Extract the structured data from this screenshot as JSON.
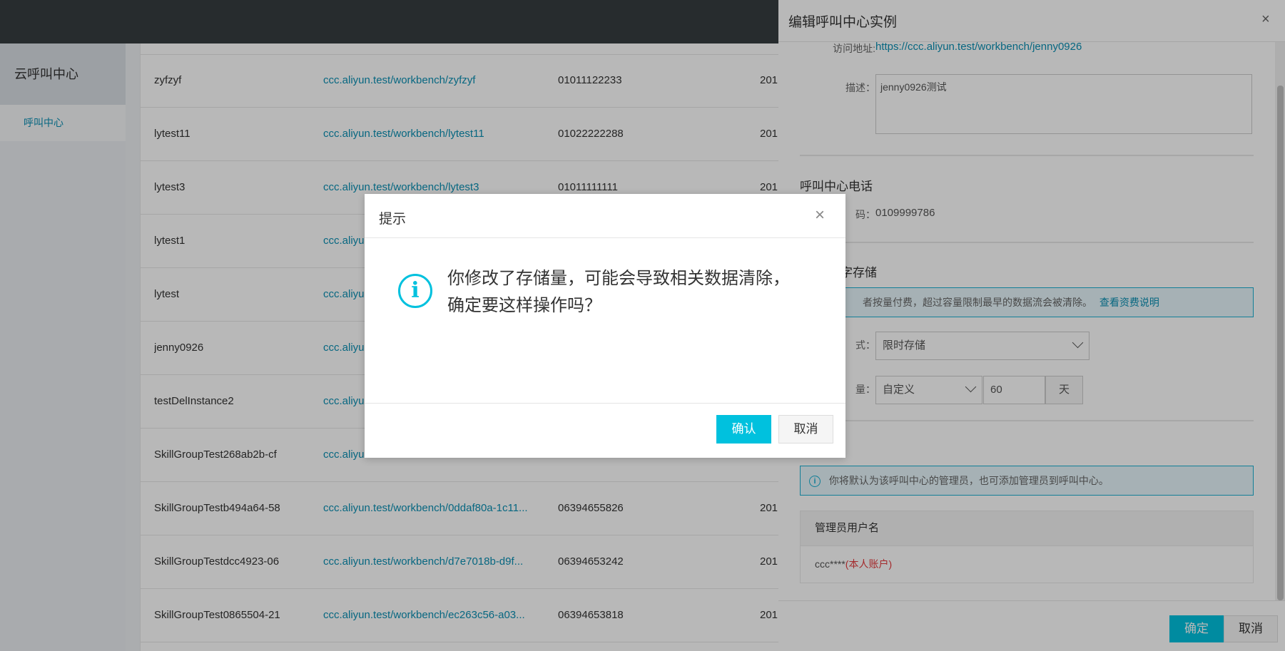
{
  "nav": {
    "title": "云呼叫中心",
    "active_item": "呼叫中心"
  },
  "table": {
    "rows": [
      {
        "name": "zyfzyf",
        "url": "ccc.aliyun.test/workbench/zyfzyf",
        "phone": "01011122233",
        "date": "201"
      },
      {
        "name": "lytest11",
        "url": "ccc.aliyun.test/workbench/lytest11",
        "phone": "01022222288",
        "date": "201"
      },
      {
        "name": "lytest3",
        "url": "ccc.aliyun.test/workbench/lytest3",
        "phone": "01011111111",
        "date": "201"
      },
      {
        "name": "lytest1",
        "url": "ccc.aliyu",
        "phone": "",
        "date": ""
      },
      {
        "name": "lytest",
        "url": "ccc.aliyu",
        "phone": "",
        "date": ""
      },
      {
        "name": "jenny0926",
        "url": "ccc.aliyu",
        "phone": "",
        "date": ""
      },
      {
        "name": "testDelInstance2",
        "url": "ccc.aliyu",
        "phone": "",
        "date": ""
      },
      {
        "name": "SkillGroupTest268ab2b-cf",
        "url": "ccc.aliyu",
        "phone": "",
        "date": ""
      },
      {
        "name": "SkillGroupTestb494a64-58",
        "url": "ccc.aliyun.test/workbench/0ddaf80a-1c11...",
        "phone": "06394655826",
        "date": "201"
      },
      {
        "name": "SkillGroupTestdcc4923-06",
        "url": "ccc.aliyun.test/workbench/d7e7018b-d9f...",
        "phone": "06394653242",
        "date": "201"
      },
      {
        "name": "SkillGroupTest0865504-21",
        "url": "ccc.aliyun.test/workbench/ec263c56-a03...",
        "phone": "06394653818",
        "date": "201"
      }
    ]
  },
  "panel": {
    "title": "编辑呼叫中心实例",
    "close_icon": "×",
    "access_label": "访问地址:",
    "access_url": "https://ccc.aliyun.test/workbench/jenny0926",
    "desc_label": "描述：",
    "desc_value": "jenny0926测试",
    "phone_section": "呼叫中心电话",
    "phone_label": "码：",
    "phone_value": "0109999786",
    "storage_section": "字存储",
    "storage_notice": "者按量付费，超过容量限制最早的数据流会被清除。",
    "storage_notice_link": "查看资费说明",
    "mode_label": "式：",
    "mode_value": "限时存储",
    "capacity_label": "量：",
    "capacity_type": "自定义",
    "capacity_value": "60",
    "capacity_unit": "天",
    "admin_notice": "你将默认为该呼叫中心的管理员，也可添加管理员到呼叫中心。",
    "admin_table_header": "管理员用户名",
    "admin_user": "ccc****",
    "admin_user_tag": "(本人账户)",
    "ok_button": "确定",
    "cancel_button": "取消"
  },
  "modal": {
    "title": "提示",
    "close_icon": "×",
    "info_icon": "i",
    "message_line1": "你修改了存储量，可能会导致相关数据清除，",
    "message_line2": "确定要这样操作吗？",
    "confirm_button": "确认",
    "cancel_button": "取消"
  },
  "colors": {
    "accent": "#00c1de",
    "link": "#0a8fb3",
    "topbar": "#373d41",
    "danger": "#e4393c"
  }
}
